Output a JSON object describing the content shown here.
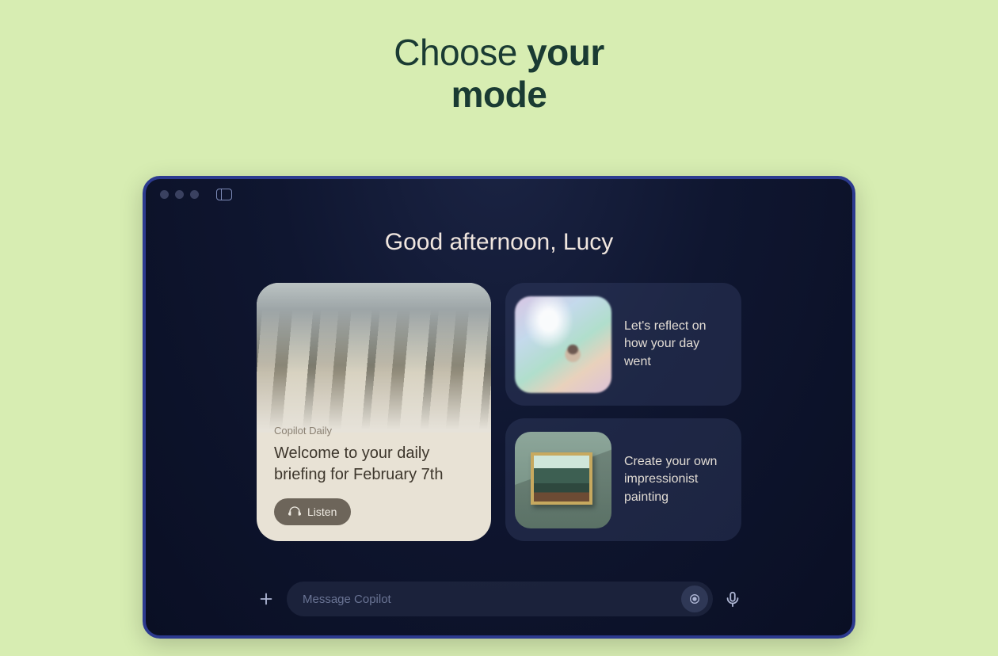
{
  "page": {
    "heading_light": "Choose ",
    "heading_bold_1": "your",
    "heading_bold_2": "mode"
  },
  "app": {
    "greeting": "Good afternoon, Lucy",
    "daily": {
      "label": "Copilot Daily",
      "title": "Welcome to your daily briefing for February 7th",
      "listen_label": "Listen"
    },
    "suggestions": [
      {
        "text": "Let's reflect on how your day went"
      },
      {
        "text": "Create your own impressionist painting"
      }
    ],
    "input": {
      "placeholder": "Message Copilot"
    }
  }
}
